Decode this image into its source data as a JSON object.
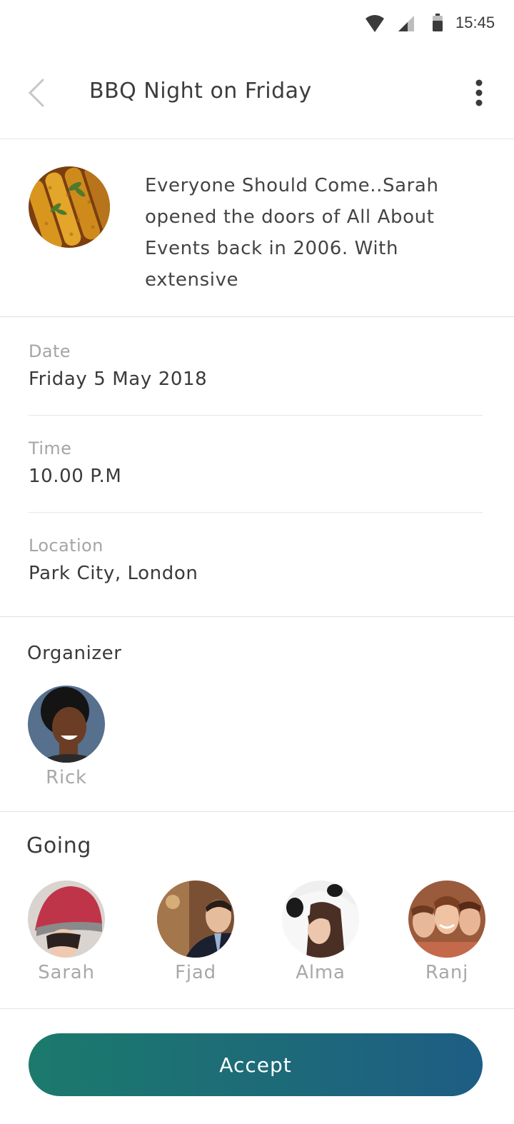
{
  "status_bar": {
    "time": "15:45",
    "icons": [
      "wifi-icon",
      "cell-signal-icon",
      "battery-icon"
    ]
  },
  "header": {
    "title": "BBQ Night on Friday",
    "back_icon": "chevron-left-icon",
    "menu_icon": "more-vertical-icon"
  },
  "event": {
    "image": "grilled-corn-photo",
    "description": "Everyone Should Come..Sarah opened the doors of All About Events back in 2006. With extensive"
  },
  "details": {
    "date_label": "Date",
    "date_value": "Friday 5 May 2018",
    "time_label": "Time",
    "time_value": "10.00 P.M",
    "location_label": "Location",
    "location_value": "Park City, London"
  },
  "organizer": {
    "title": "Organizer",
    "name": "Rick"
  },
  "going": {
    "title": "Going",
    "people": [
      {
        "name": "Sarah"
      },
      {
        "name": "Fjad"
      },
      {
        "name": "Alma"
      },
      {
        "name": "Ranj"
      }
    ]
  },
  "actions": {
    "accept_label": "Accept"
  },
  "colors": {
    "accent_start": "#1c7a6c",
    "accent_end": "#1e5d84",
    "label_gray": "#a5a5a5",
    "divider": "#e0e0e0"
  }
}
